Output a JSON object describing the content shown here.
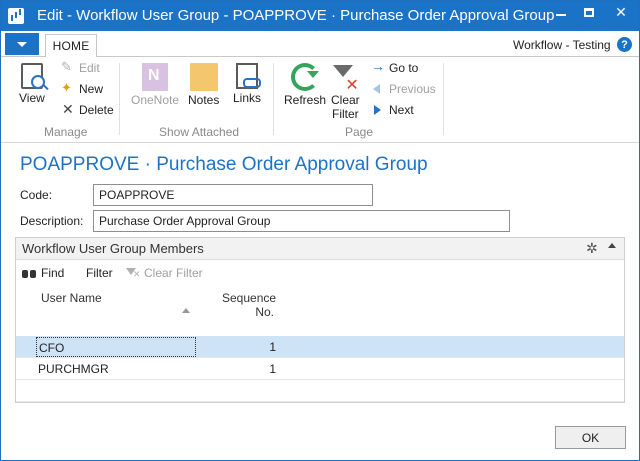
{
  "window": {
    "title": "Edit - Workflow User Group - POAPPROVE · Purchase Order Approval Group",
    "controls": {
      "minimize": "",
      "maximize": "",
      "close": "✕"
    }
  },
  "ribbon": {
    "tabs": [
      {
        "label": "HOME",
        "active": true
      }
    ],
    "company": "Workflow - Testing",
    "help": "?",
    "groups": {
      "manage": {
        "caption": "Manage",
        "view": "View",
        "edit": "Edit",
        "new": "New",
        "delete": "Delete"
      },
      "show_attached": {
        "caption": "Show Attached",
        "onenote": "OneNote",
        "notes": "Notes",
        "links": "Links"
      },
      "page": {
        "caption": "Page",
        "refresh": "Refresh",
        "clear_filter_line1": "Clear",
        "clear_filter_line2": "Filter",
        "goto": "Go to",
        "previous": "Previous",
        "next": "Next"
      }
    }
  },
  "card": {
    "heading": "POAPPROVE · Purchase Order Approval Group",
    "code_label": "Code:",
    "code_value": "POAPPROVE",
    "description_label": "Description:",
    "description_value": "Purchase Order Approval Group"
  },
  "subpage": {
    "title": "Workflow User Group Members",
    "actions": {
      "find": "Find",
      "filter": "Filter",
      "clear_filter": "Clear Filter"
    },
    "columns": {
      "user_name": "User Name",
      "sequence_line1": "Sequence",
      "sequence_line2": "No."
    },
    "rows": [
      {
        "user_name": "CFO",
        "sequence_no": "1",
        "selected": true
      },
      {
        "user_name": "PURCHMGR",
        "sequence_no": "1",
        "selected": false
      }
    ]
  },
  "footer": {
    "ok": "OK"
  },
  "colors": {
    "accent": "#1b73c8",
    "selected_row": "#cfe3f7",
    "refresh_green": "#36a35a",
    "clear_red": "#d9412a"
  }
}
